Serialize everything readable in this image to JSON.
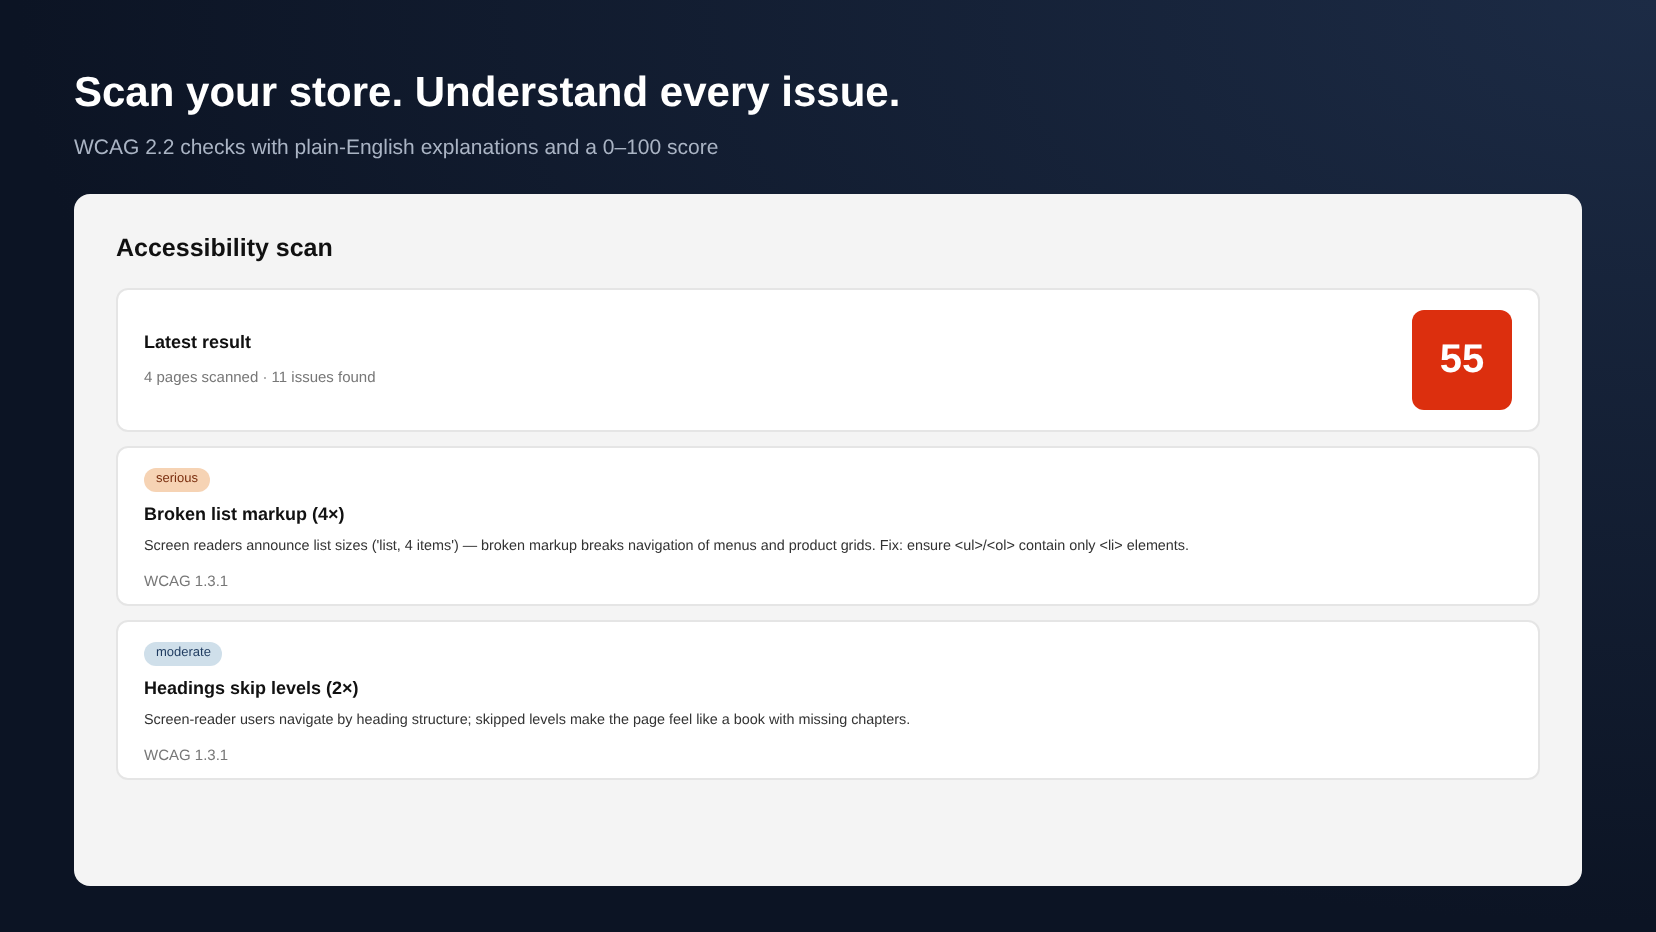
{
  "header": {
    "title": "Scan your store. Understand every issue.",
    "subtitle": "WCAG 2.2 checks with plain-English explanations and a 0–100 score"
  },
  "panel": {
    "title": "Accessibility scan",
    "summary": {
      "title": "Latest result",
      "details": "4 pages scanned · 11 issues found",
      "score": "55"
    },
    "issues": [
      {
        "severity": "serious",
        "title": "Broken list markup (4×)",
        "description": "Screen readers announce list sizes ('list, 4 items') — broken markup breaks navigation of menus and product grids. Fix: ensure <ul>/<ol> contain only <li> elements.",
        "reference": "WCAG 1.3.1"
      },
      {
        "severity": "moderate",
        "title": "Headings skip levels (2×)",
        "description": "Screen-reader users navigate by heading structure; skipped levels make the page feel like a book with missing chapters.",
        "reference": "WCAG 1.3.1"
      }
    ]
  }
}
